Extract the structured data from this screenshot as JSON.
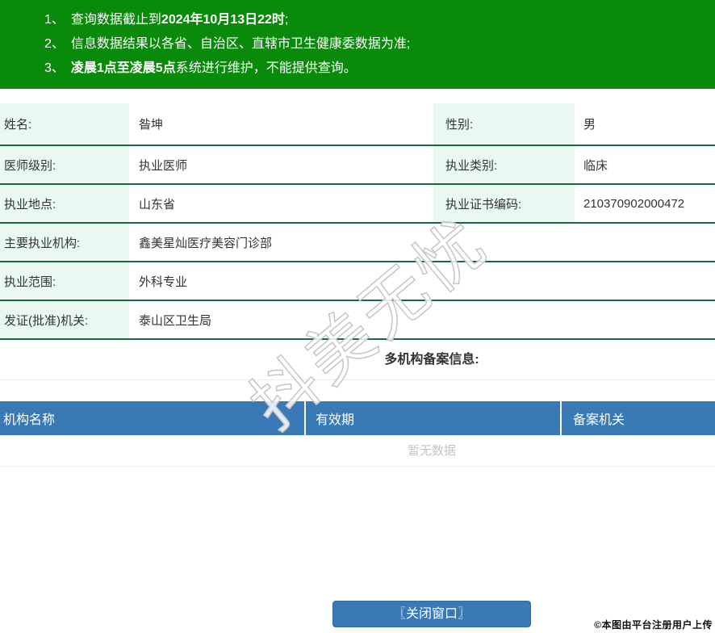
{
  "notice": {
    "lines": [
      {
        "num": "1、",
        "pre": "查询数据截止到",
        "bold": "2024年10月13日22时",
        "post": ";"
      },
      {
        "num": "2、",
        "pre": "信息数据结果以各省、自治区、直辖市卫生健康委数据为准;",
        "bold": "",
        "post": ""
      },
      {
        "num": "3、",
        "pre": "",
        "bold": "凌晨1点至凌晨5点",
        "post": "系统进行维护，不能提供查询。"
      }
    ]
  },
  "info": {
    "rows": [
      {
        "label1": "姓名:",
        "value1": "昝坤",
        "label2": "性别:",
        "value2": "男"
      },
      {
        "label1": "医师级别:",
        "value1": "执业医师",
        "label2": "执业类别:",
        "value2": "临床"
      },
      {
        "label1": "执业地点:",
        "value1": "山东省",
        "label2": "执业证书编码:",
        "value2": "210370902000472"
      },
      {
        "label1": "主要执业机构:",
        "value1": "鑫美星灿医疗美容门诊部"
      },
      {
        "label1": "执业范围:",
        "value1": "外科专业"
      },
      {
        "label1": "发证(批准)机关:",
        "value1": "泰山区卫生局"
      }
    ]
  },
  "section": {
    "heading": "多机构备案信息:"
  },
  "filing": {
    "headers": [
      "机构名称",
      "有效期",
      "备案机关"
    ],
    "empty_text": "暂无数据"
  },
  "footer": {
    "close_label": "〖关闭窗口〗"
  },
  "watermark": {
    "diagonal_text": "抖美无忧",
    "stamp_text": "©本图由平台注册用户上传"
  },
  "colors": {
    "header_green": "#0a8a0a",
    "label_mint": "#e9f9f1",
    "row_border_green": "#19693f",
    "table_blue": "#3879b6",
    "empty_gray": "#c0c4cc"
  }
}
